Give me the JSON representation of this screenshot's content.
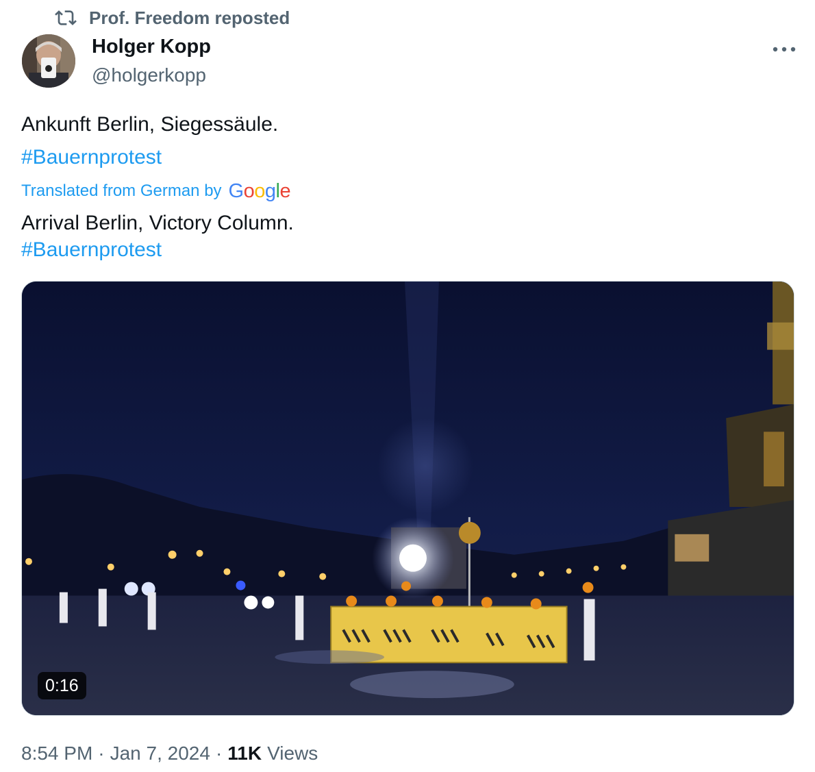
{
  "repost": {
    "label": "Prof. Freedom reposted"
  },
  "author": {
    "name": "Holger Kopp",
    "handle": "@holgerkopp"
  },
  "tweet": {
    "original_text": "Ankunft Berlin, Siegessäule.",
    "original_hashtag": "#Bauernprotest",
    "translated_from": "Translated from German by",
    "translator_brand": "Google",
    "translated_text": "Arrival Berlin, Victory Column.",
    "translated_hashtag": "#Bauernprotest"
  },
  "media": {
    "type": "video",
    "duration": "0:16"
  },
  "meta": {
    "time": "8:54 PM",
    "separator": "·",
    "date": "Jan 7, 2024",
    "views_count": "11K",
    "views_label": "Views"
  },
  "colors": {
    "accent": "#1d9bf0",
    "text_primary": "#0f1419",
    "text_secondary": "#536471",
    "google_blue": "#4285f4",
    "google_red": "#ea4335",
    "google_yellow": "#fbbc05",
    "google_green": "#34a853"
  },
  "icons": {
    "repost": "repost-icon",
    "more": "more-icon"
  }
}
